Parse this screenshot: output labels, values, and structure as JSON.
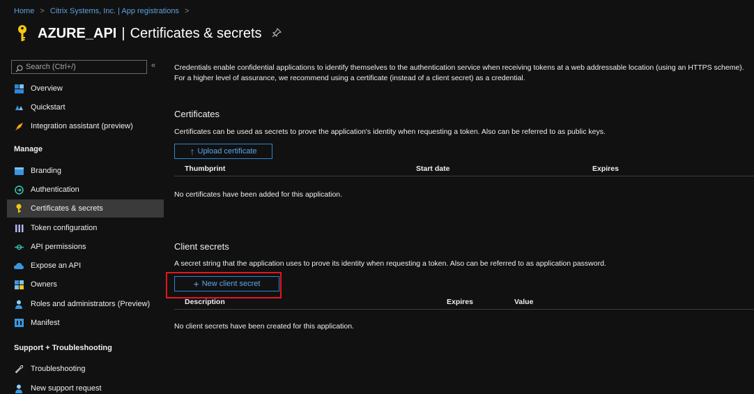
{
  "breadcrumb": {
    "items": [
      "Home",
      "Citrix Systems, Inc. | App registrations"
    ],
    "separator": ">"
  },
  "title": {
    "app_name": "AZURE_API",
    "divider": "|",
    "page_name": "Certificates & secrets"
  },
  "sidebar": {
    "search_placeholder": "Search (Ctrl+/)",
    "collapse_glyph": "«",
    "items": [
      {
        "label": "Overview",
        "icon": "overview-icon",
        "active": false
      },
      {
        "label": "Quickstart",
        "icon": "quickstart-icon",
        "active": false
      },
      {
        "label": "Integration assistant (preview)",
        "icon": "rocket-icon",
        "active": false
      }
    ],
    "manage_heading": "Manage",
    "manage_items": [
      {
        "label": "Branding",
        "icon": "branding-icon",
        "active": false
      },
      {
        "label": "Authentication",
        "icon": "authentication-icon",
        "active": false
      },
      {
        "label": "Certificates & secrets",
        "icon": "key-icon",
        "active": true
      },
      {
        "label": "Token configuration",
        "icon": "token-icon",
        "active": false
      },
      {
        "label": "API permissions",
        "icon": "api-permissions-icon",
        "active": false
      },
      {
        "label": "Expose an API",
        "icon": "cloud-icon",
        "active": false
      },
      {
        "label": "Owners",
        "icon": "owners-icon",
        "active": false
      },
      {
        "label": "Roles and administrators (Preview)",
        "icon": "roles-icon",
        "active": false
      },
      {
        "label": "Manifest",
        "icon": "manifest-icon",
        "active": false
      }
    ],
    "support_heading": "Support + Troubleshooting",
    "support_items": [
      {
        "label": "Troubleshooting",
        "icon": "wrench-icon",
        "active": false
      },
      {
        "label": "New support request",
        "icon": "support-person-icon",
        "active": false
      }
    ]
  },
  "main": {
    "intro": "Credentials enable confidential applications to identify themselves to the authentication service when receiving tokens at a web addressable location (using an HTTPS scheme). For a higher level of assurance, we recommend using a certificate (instead of a client secret) as a credential.",
    "certificates": {
      "heading": "Certificates",
      "description": "Certificates can be used as secrets to prove the application's identity when requesting a token. Also can be referred to as public keys.",
      "upload_button": "Upload certificate",
      "columns": [
        "Thumbprint",
        "Start date",
        "Expires"
      ],
      "empty_message": "No certificates have been added for this application."
    },
    "client_secrets": {
      "heading": "Client secrets",
      "description": "A secret string that the application uses to prove its identity when requesting a token. Also can be referred to as application password.",
      "new_button": "New client secret",
      "columns": [
        "Description",
        "Expires",
        "Value"
      ],
      "empty_message": "No client secrets have been created for this application."
    }
  },
  "colors": {
    "background": "#111111",
    "accent": "#2f86d6",
    "key_yellow": "#f2c811",
    "highlight": "#e8151b",
    "active_item": "#3a3a3a"
  }
}
